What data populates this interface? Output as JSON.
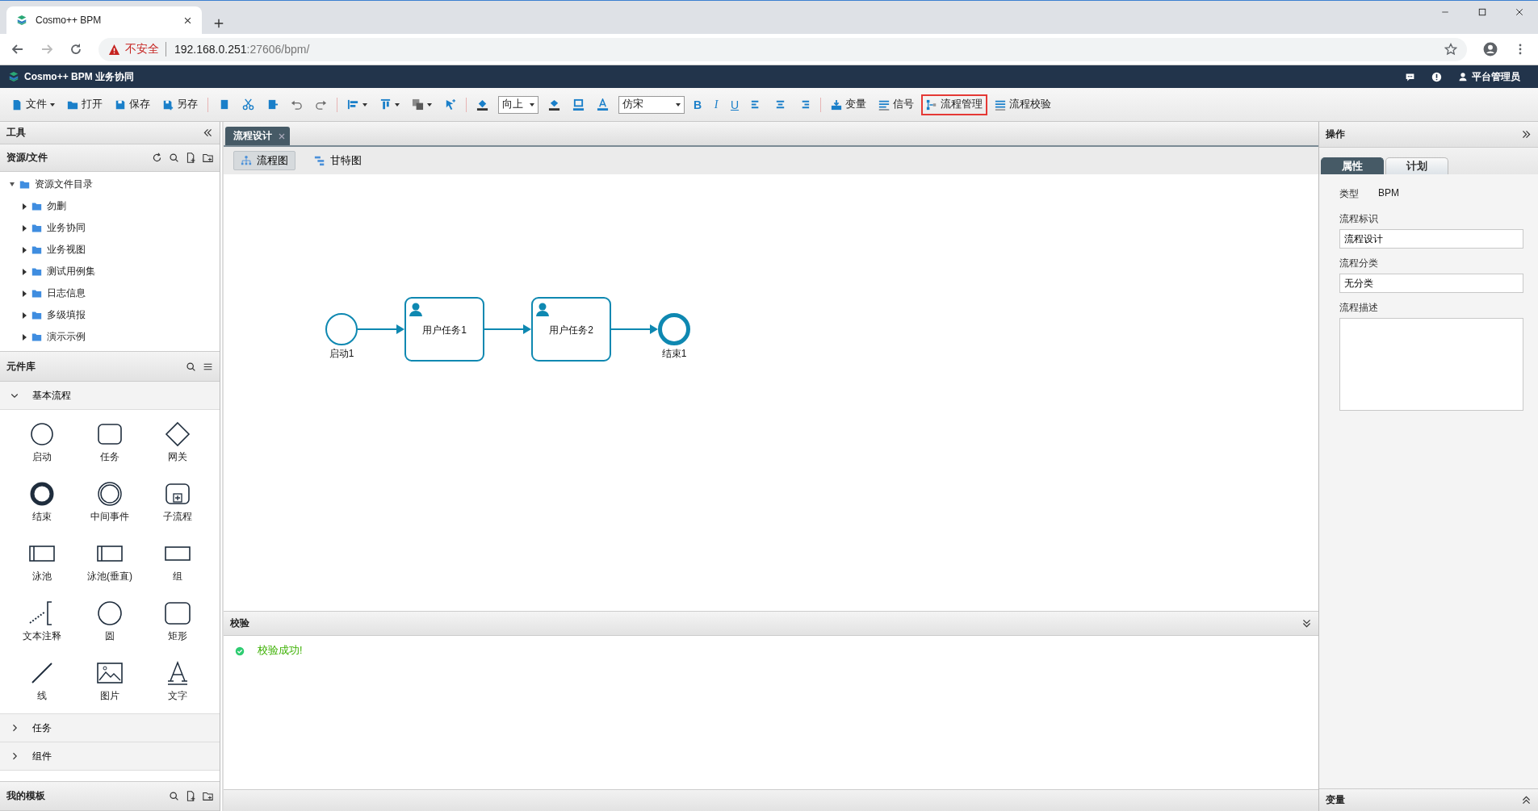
{
  "browser": {
    "tab_title": "Cosmo++ BPM",
    "security_label": "不安全",
    "url_host": "192.168.0.251",
    "url_rest": ":27606/bpm/"
  },
  "app_header": {
    "title": "Cosmo++ BPM 业务协同",
    "user": "平台管理员"
  },
  "toolbar": {
    "groups": [
      [
        {
          "kind": "button",
          "label": "文件",
          "dropdown": true,
          "highlighted": false
        },
        {
          "kind": "button",
          "label": "打开",
          "dropdown": false,
          "highlighted": false
        },
        {
          "kind": "button",
          "label": "保存",
          "dropdown": false,
          "highlighted": false
        },
        {
          "kind": "button",
          "label": "另存",
          "dropdown": false,
          "highlighted": false
        }
      ],
      [
        {
          "kind": "icon",
          "dropdown": false
        },
        {
          "kind": "icon",
          "dropdown": false
        },
        {
          "kind": "icon",
          "dropdown": false
        },
        {
          "kind": "icon",
          "dropdown": false
        },
        {
          "kind": "icon",
          "dropdown": false
        }
      ],
      [
        {
          "kind": "icon",
          "dropdown": true
        },
        {
          "kind": "icon",
          "dropdown": true
        },
        {
          "kind": "icon",
          "dropdown": true
        },
        {
          "kind": "icon",
          "dropdown": false
        }
      ],
      [
        {
          "kind": "icon",
          "dropdown": false
        },
        {
          "kind": "select",
          "value": "向上"
        },
        {
          "kind": "icon",
          "dropdown": false
        },
        {
          "kind": "icon",
          "dropdown": false
        },
        {
          "kind": "icon",
          "dropdown": false
        },
        {
          "kind": "select",
          "value": "仿宋"
        },
        {
          "kind": "glyph",
          "label": "B"
        },
        {
          "kind": "glyph",
          "label": "I"
        },
        {
          "kind": "glyph",
          "label": "U"
        },
        {
          "kind": "icon",
          "dropdown": false
        },
        {
          "kind": "icon",
          "dropdown": false
        },
        {
          "kind": "icon",
          "dropdown": false
        }
      ],
      [
        {
          "kind": "button",
          "label": "变量",
          "dropdown": false,
          "highlighted": false
        },
        {
          "kind": "button",
          "label": "信号",
          "dropdown": false,
          "highlighted": false
        },
        {
          "kind": "button",
          "label": "流程管理",
          "dropdown": false,
          "highlighted": true
        },
        {
          "kind": "button",
          "label": "流程校验",
          "dropdown": false,
          "highlighted": false
        }
      ]
    ]
  },
  "left_panel": {
    "title": "工具",
    "resources": {
      "title": "资源/文件",
      "tree": [
        {
          "label": "资源文件目录",
          "expanded": true,
          "children": [
            {
              "label": "勿删",
              "expanded": false
            },
            {
              "label": "业务协同",
              "expanded": false
            },
            {
              "label": "业务视图",
              "expanded": false
            },
            {
              "label": "测试用例集",
              "expanded": false
            },
            {
              "label": "日志信息",
              "expanded": false
            },
            {
              "label": "多级填报",
              "expanded": false
            },
            {
              "label": "演示示例",
              "expanded": false
            }
          ]
        }
      ]
    },
    "library": {
      "title": "元件库",
      "groups": [
        {
          "label": "基本流程",
          "expanded": true,
          "items": [
            "启动",
            "任务",
            "网关",
            "结束",
            "中间事件",
            "子流程",
            "泳池",
            "泳池(垂直)",
            "组",
            "文本注释",
            "圆",
            "矩形",
            "线",
            "图片",
            "文字"
          ]
        },
        {
          "label": "任务",
          "expanded": false
        },
        {
          "label": "组件",
          "expanded": false
        }
      ]
    },
    "templates": {
      "title": "我的模板"
    }
  },
  "editor_tabs": [
    {
      "label": "流程设计",
      "selected": true
    }
  ],
  "view_buttons": [
    {
      "label": "流程图",
      "selected": true
    },
    {
      "label": "甘特图",
      "selected": false
    }
  ],
  "diagram": {
    "nodes": [
      {
        "kind": "start",
        "label": "启动1"
      },
      {
        "kind": "user_task",
        "label": "用户任务1"
      },
      {
        "kind": "user_task",
        "label": "用户任务2"
      },
      {
        "kind": "end",
        "label": "结束1"
      }
    ]
  },
  "validation": {
    "title": "校验",
    "messages": [
      {
        "kind": "success",
        "text": "校验成功!"
      }
    ]
  },
  "right_panel": {
    "title": "操作",
    "tabs": [
      {
        "label": "属性",
        "selected": true
      },
      {
        "label": "计划",
        "selected": false
      }
    ],
    "type_label": "类型",
    "type_value": "BPM",
    "fields": [
      {
        "label": "流程标识",
        "kind": "input",
        "value": "流程设计"
      },
      {
        "label": "流程分类",
        "kind": "input",
        "value": "无分类"
      },
      {
        "label": "流程描述",
        "kind": "textarea"
      }
    ],
    "footer": "变量"
  }
}
